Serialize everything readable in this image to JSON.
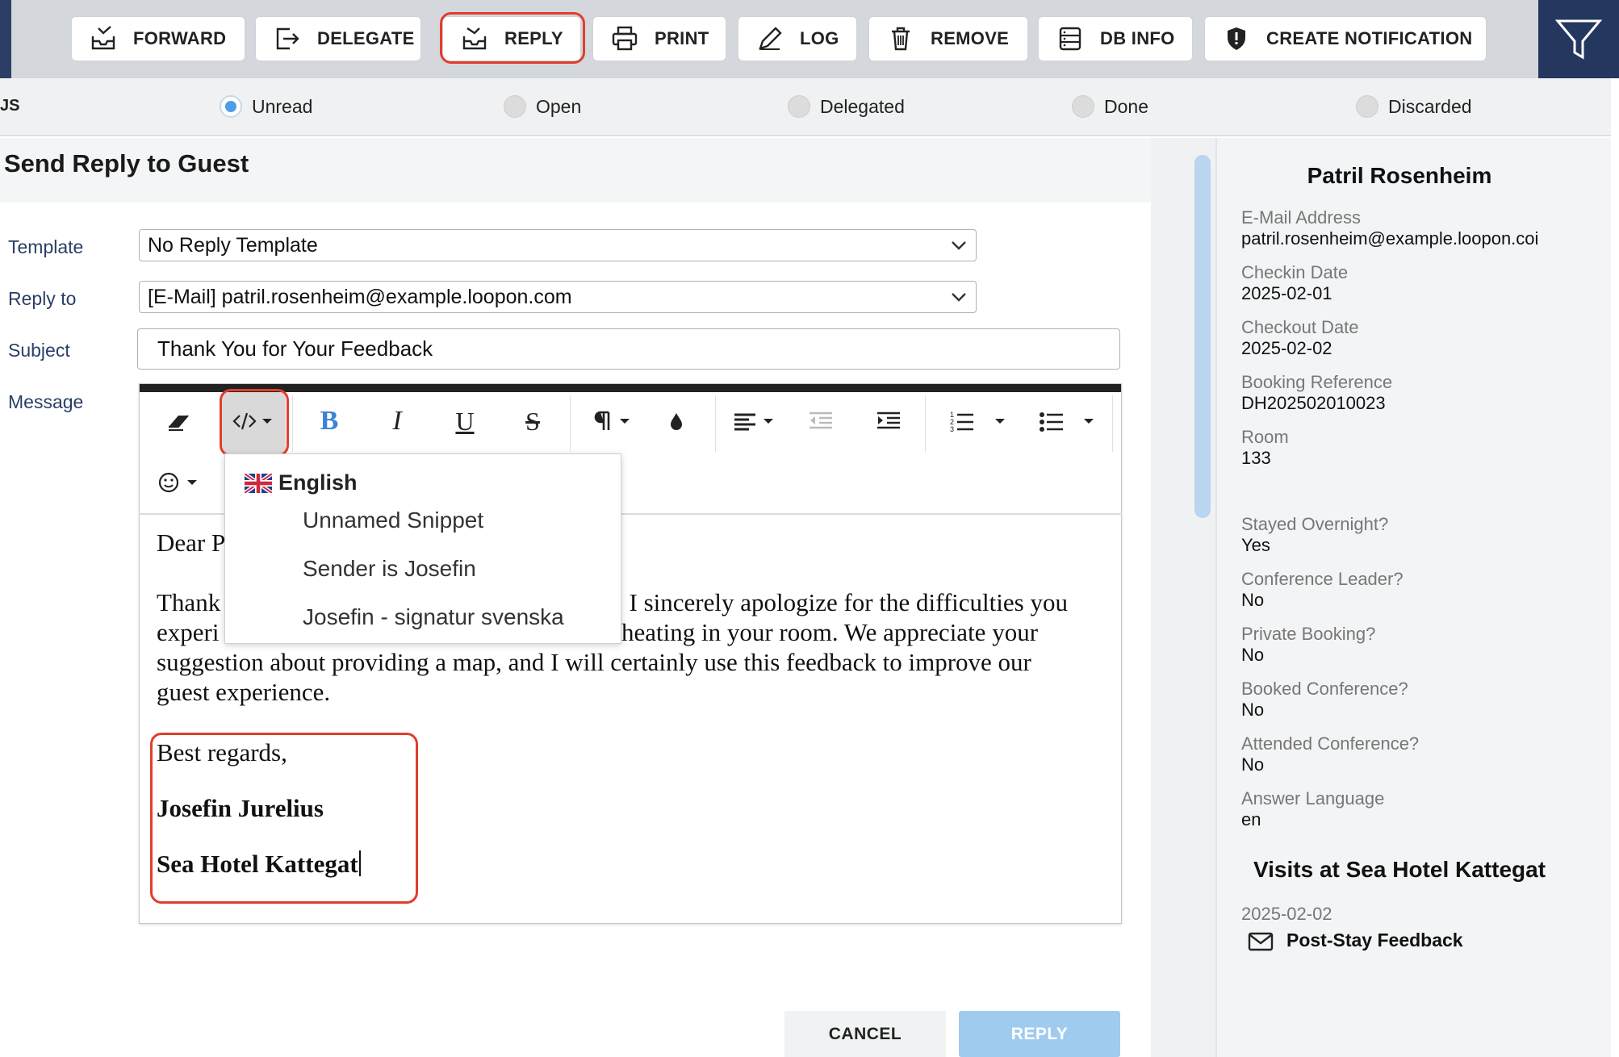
{
  "toolbar": {
    "buttons": [
      {
        "label": "FORWARD",
        "icon": "forward-inbox-icon"
      },
      {
        "label": "DELEGATE",
        "icon": "delegate-arrow-icon"
      },
      {
        "label": "REPLY",
        "icon": "reply-inbox-icon"
      },
      {
        "label": "PRINT",
        "icon": "printer-icon"
      },
      {
        "label": "LOG",
        "icon": "pencil-icon"
      },
      {
        "label": "REMOVE",
        "icon": "trash-icon"
      },
      {
        "label": "DB INFO",
        "icon": "database-icon"
      },
      {
        "label": "CREATE NOTIFICATION",
        "icon": "shield-alert-icon"
      }
    ],
    "filter_icon": "filter-funnel-icon"
  },
  "status": {
    "label_fragment": "JS",
    "options": [
      {
        "label": "Unread",
        "selected": true
      },
      {
        "label": "Open",
        "selected": false
      },
      {
        "label": "Delegated",
        "selected": false
      },
      {
        "label": "Done",
        "selected": false
      },
      {
        "label": "Discarded",
        "selected": false
      }
    ]
  },
  "form": {
    "title": "Send Reply to Guest",
    "template_label": "Template",
    "template_value": "No Reply Template",
    "reply_to_label": "Reply to",
    "reply_to_value": "[E-Mail] patril.rosenheim@example.loopon.com",
    "subject_label": "Subject",
    "subject_value": "Thank You for Your Feedback",
    "message_label": "Message"
  },
  "editor": {
    "tools": [
      "eraser-icon",
      "code-snippet-icon",
      "bold-icon",
      "italic-icon",
      "underline-icon",
      "strikethrough-icon",
      "paragraph-icon",
      "color-drop-icon",
      "align-icon",
      "outdent-icon",
      "indent-icon",
      "ordered-list-icon",
      "unordered-list-icon",
      "emoji-icon"
    ],
    "content": {
      "greeting": "Dear P",
      "para_line1_left": "Thank",
      "para_line1_right": ". I sincerely apologize for the difficulties you",
      "para_line2_left": "experi",
      "para_line2_right": "heating in your room. We appreciate your",
      "para_line3": "suggestion about providing a map, and I will certainly use this feedback to improve our",
      "para_line4": "guest experience.",
      "closing": "Best regards,",
      "signature_name": "Josefin Jurelius",
      "signature_hotel": "Sea Hotel Kattegat"
    }
  },
  "snippet_menu": {
    "group": "English",
    "group_icon": "uk-flag-icon",
    "items": [
      "Unnamed Snippet",
      "Sender is Josefin",
      "Josefin - signatur svenska"
    ]
  },
  "actions": {
    "cancel": "CANCEL",
    "reply": "REPLY"
  },
  "guest": {
    "name": "Patril Rosenheim",
    "fields": [
      {
        "label": "E-Mail Address",
        "value": "patril.rosenheim@example.loopon.coi"
      },
      {
        "label": "Checkin Date",
        "value": "2025-02-01"
      },
      {
        "label": "Checkout Date",
        "value": "2025-02-02"
      },
      {
        "label": "Booking Reference",
        "value": "DH202502010023"
      },
      {
        "label": "Room",
        "value": "133"
      },
      {
        "label": "Stayed Overnight?",
        "value": "Yes"
      },
      {
        "label": "Conference Leader?",
        "value": "No"
      },
      {
        "label": "Private Booking?",
        "value": "No"
      },
      {
        "label": "Booked Conference?",
        "value": "No"
      },
      {
        "label": "Attended Conference?",
        "value": "No"
      },
      {
        "label": "Answer Language",
        "value": "en"
      }
    ],
    "visits_title": "Visits at Sea Hotel Kattegat",
    "visit_date": "2025-02-02",
    "visit_item": "Post-Stay Feedback",
    "visit_icon": "envelope-icon"
  },
  "colors": {
    "highlight": "#e03e2d",
    "nav_dark": "#24375e",
    "reply_disabled": "#9fcbef",
    "radio_selected": "#4d9ee8"
  }
}
